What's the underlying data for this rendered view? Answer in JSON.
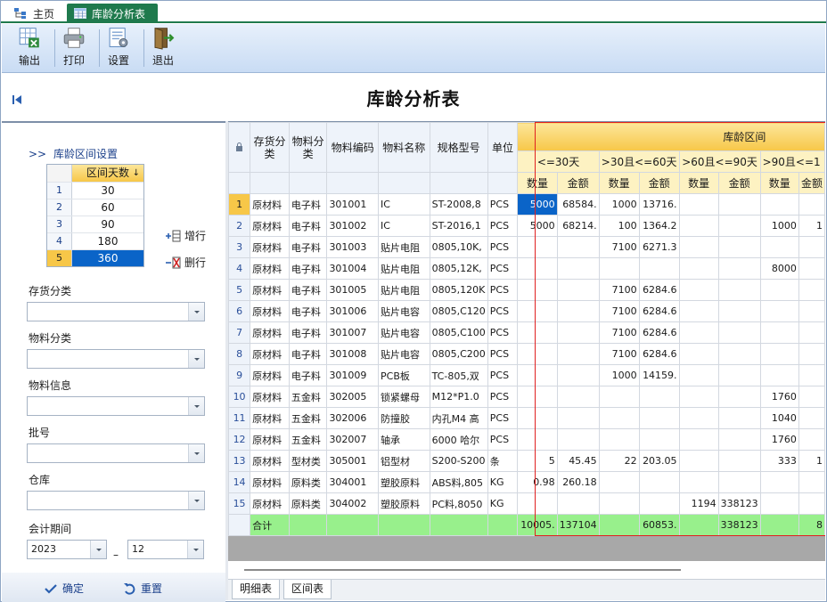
{
  "tabs": {
    "home": "主页",
    "active": "库龄分析表"
  },
  "toolbar": {
    "export": "输出",
    "print": "打印",
    "settings": "设置",
    "exit": "退出"
  },
  "title": "库龄分析表",
  "left": {
    "heading": "库龄区间设置",
    "prefix": ">>",
    "interval_header": "区间天数",
    "intervals": [
      "30",
      "60",
      "90",
      "180",
      "360"
    ],
    "add_row": "增行",
    "del_row": "删行",
    "filters": {
      "inventory_class": "存货分类",
      "material_class": "物料分类",
      "material_info": "物料信息",
      "batch": "批号",
      "warehouse": "仓库",
      "period": "会计期间"
    },
    "period_year": "2023",
    "period_sep": "–",
    "period_month": "12",
    "confirm": "确定",
    "reset": "重置"
  },
  "grid": {
    "headers": {
      "inventory_class": "存货分类",
      "material_class": "物料分类",
      "code": "物料编码",
      "name": "物料名称",
      "spec": "规格型号",
      "unit": "单位",
      "band": "库龄区间",
      "groups": [
        "<=30天",
        ">30且<=60天",
        ">60且<=90天",
        ">90且<=1"
      ],
      "qty": "数量",
      "amt": "金额"
    },
    "rows": [
      [
        "1",
        "原材料",
        "电子料",
        "301001",
        "IC",
        "ST-2008,8",
        "PCS",
        "5000",
        "68584.",
        "1000",
        "13716.",
        "",
        "",
        "",
        ""
      ],
      [
        "2",
        "原材料",
        "电子料",
        "301002",
        "IC",
        "ST-2016,1",
        "PCS",
        "5000",
        "68214.",
        "100",
        "1364.2",
        "",
        "",
        "1000",
        "1"
      ],
      [
        "3",
        "原材料",
        "电子料",
        "301003",
        "贴片电阻",
        "0805,10K,",
        "PCS",
        "",
        "",
        "7100",
        "6271.3",
        "",
        "",
        "",
        ""
      ],
      [
        "4",
        "原材料",
        "电子料",
        "301004",
        "贴片电阻",
        "0805,12K,",
        "PCS",
        "",
        "",
        "",
        "",
        "",
        "",
        "8000",
        ""
      ],
      [
        "5",
        "原材料",
        "电子料",
        "301005",
        "贴片电阻",
        "0805,120K",
        "PCS",
        "",
        "",
        "7100",
        "6284.6",
        "",
        "",
        "",
        ""
      ],
      [
        "6",
        "原材料",
        "电子料",
        "301006",
        "贴片电容",
        "0805,C120",
        "PCS",
        "",
        "",
        "7100",
        "6284.6",
        "",
        "",
        "",
        ""
      ],
      [
        "7",
        "原材料",
        "电子料",
        "301007",
        "贴片电容",
        "0805,C100",
        "PCS",
        "",
        "",
        "7100",
        "6284.6",
        "",
        "",
        "",
        ""
      ],
      [
        "8",
        "原材料",
        "电子料",
        "301008",
        "贴片电容",
        "0805,C200",
        "PCS",
        "",
        "",
        "7100",
        "6284.6",
        "",
        "",
        "",
        ""
      ],
      [
        "9",
        "原材料",
        "电子料",
        "301009",
        "PCB板",
        "TC-805,双",
        "PCS",
        "",
        "",
        "1000",
        "14159.",
        "",
        "",
        "",
        ""
      ],
      [
        "10",
        "原材料",
        "五金料",
        "302005",
        "锁紧螺母",
        "M12*P1.0",
        "PCS",
        "",
        "",
        "",
        "",
        "",
        "",
        "1760",
        ""
      ],
      [
        "11",
        "原材料",
        "五金料",
        "302006",
        "防撞胶",
        "内孔M4 高",
        "PCS",
        "",
        "",
        "",
        "",
        "",
        "",
        "1040",
        ""
      ],
      [
        "12",
        "原材料",
        "五金料",
        "302007",
        "轴承",
        "6000 哈尔",
        "PCS",
        "",
        "",
        "",
        "",
        "",
        "",
        "1760",
        ""
      ],
      [
        "13",
        "原材料",
        "型材类",
        "305001",
        "铝型材",
        "S200-S200",
        "条",
        "5",
        "45.45",
        "22",
        "203.05",
        "",
        "",
        "333",
        "1"
      ],
      [
        "14",
        "原材料",
        "原料类",
        "304001",
        "塑胶原料",
        "ABS料,805",
        "KG",
        "0.98",
        "260.18",
        "",
        "",
        "",
        "",
        "",
        ""
      ],
      [
        "15",
        "原材料",
        "原料类",
        "304002",
        "塑胶原料",
        "PC料,8050",
        "KG",
        "",
        "",
        "",
        "",
        "1194",
        "338123",
        "",
        ""
      ]
    ],
    "total": [
      "合计",
      "",
      "",
      "",
      "",
      "",
      "10005.",
      "137104",
      "",
      "60853.",
      "",
      "338123",
      "",
      "8"
    ]
  },
  "bottom_tabs": [
    "明细表",
    "区间表"
  ]
}
